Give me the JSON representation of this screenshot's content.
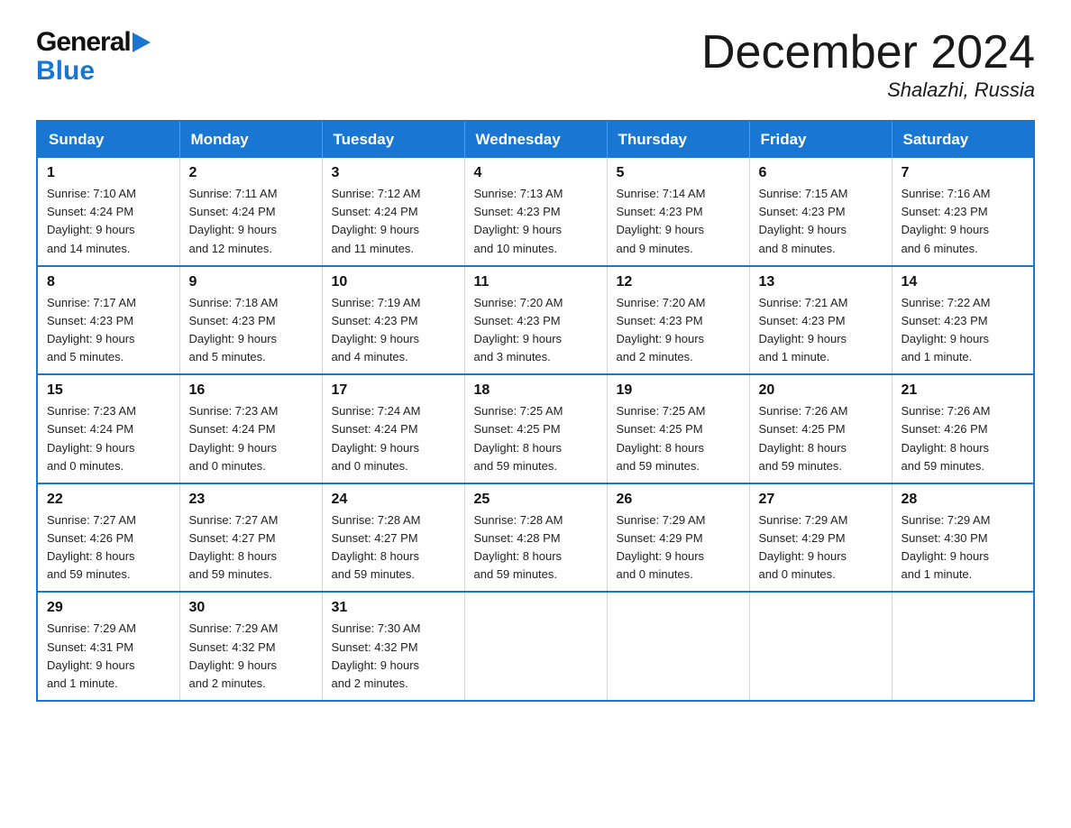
{
  "header": {
    "logo_general": "General",
    "logo_blue": "Blue",
    "month_title": "December 2024",
    "location": "Shalazhi, Russia"
  },
  "days_of_week": [
    "Sunday",
    "Monday",
    "Tuesday",
    "Wednesday",
    "Thursday",
    "Friday",
    "Saturday"
  ],
  "weeks": [
    [
      {
        "day": "1",
        "sunrise": "7:10 AM",
        "sunset": "4:24 PM",
        "daylight": "9 hours and 14 minutes."
      },
      {
        "day": "2",
        "sunrise": "7:11 AM",
        "sunset": "4:24 PM",
        "daylight": "9 hours and 12 minutes."
      },
      {
        "day": "3",
        "sunrise": "7:12 AM",
        "sunset": "4:24 PM",
        "daylight": "9 hours and 11 minutes."
      },
      {
        "day": "4",
        "sunrise": "7:13 AM",
        "sunset": "4:23 PM",
        "daylight": "9 hours and 10 minutes."
      },
      {
        "day": "5",
        "sunrise": "7:14 AM",
        "sunset": "4:23 PM",
        "daylight": "9 hours and 9 minutes."
      },
      {
        "day": "6",
        "sunrise": "7:15 AM",
        "sunset": "4:23 PM",
        "daylight": "9 hours and 8 minutes."
      },
      {
        "day": "7",
        "sunrise": "7:16 AM",
        "sunset": "4:23 PM",
        "daylight": "9 hours and 6 minutes."
      }
    ],
    [
      {
        "day": "8",
        "sunrise": "7:17 AM",
        "sunset": "4:23 PM",
        "daylight": "9 hours and 5 minutes."
      },
      {
        "day": "9",
        "sunrise": "7:18 AM",
        "sunset": "4:23 PM",
        "daylight": "9 hours and 5 minutes."
      },
      {
        "day": "10",
        "sunrise": "7:19 AM",
        "sunset": "4:23 PM",
        "daylight": "9 hours and 4 minutes."
      },
      {
        "day": "11",
        "sunrise": "7:20 AM",
        "sunset": "4:23 PM",
        "daylight": "9 hours and 3 minutes."
      },
      {
        "day": "12",
        "sunrise": "7:20 AM",
        "sunset": "4:23 PM",
        "daylight": "9 hours and 2 minutes."
      },
      {
        "day": "13",
        "sunrise": "7:21 AM",
        "sunset": "4:23 PM",
        "daylight": "9 hours and 1 minute."
      },
      {
        "day": "14",
        "sunrise": "7:22 AM",
        "sunset": "4:23 PM",
        "daylight": "9 hours and 1 minute."
      }
    ],
    [
      {
        "day": "15",
        "sunrise": "7:23 AM",
        "sunset": "4:24 PM",
        "daylight": "9 hours and 0 minutes."
      },
      {
        "day": "16",
        "sunrise": "7:23 AM",
        "sunset": "4:24 PM",
        "daylight": "9 hours and 0 minutes."
      },
      {
        "day": "17",
        "sunrise": "7:24 AM",
        "sunset": "4:24 PM",
        "daylight": "9 hours and 0 minutes."
      },
      {
        "day": "18",
        "sunrise": "7:25 AM",
        "sunset": "4:25 PM",
        "daylight": "8 hours and 59 minutes."
      },
      {
        "day": "19",
        "sunrise": "7:25 AM",
        "sunset": "4:25 PM",
        "daylight": "8 hours and 59 minutes."
      },
      {
        "day": "20",
        "sunrise": "7:26 AM",
        "sunset": "4:25 PM",
        "daylight": "8 hours and 59 minutes."
      },
      {
        "day": "21",
        "sunrise": "7:26 AM",
        "sunset": "4:26 PM",
        "daylight": "8 hours and 59 minutes."
      }
    ],
    [
      {
        "day": "22",
        "sunrise": "7:27 AM",
        "sunset": "4:26 PM",
        "daylight": "8 hours and 59 minutes."
      },
      {
        "day": "23",
        "sunrise": "7:27 AM",
        "sunset": "4:27 PM",
        "daylight": "8 hours and 59 minutes."
      },
      {
        "day": "24",
        "sunrise": "7:28 AM",
        "sunset": "4:27 PM",
        "daylight": "8 hours and 59 minutes."
      },
      {
        "day": "25",
        "sunrise": "7:28 AM",
        "sunset": "4:28 PM",
        "daylight": "8 hours and 59 minutes."
      },
      {
        "day": "26",
        "sunrise": "7:29 AM",
        "sunset": "4:29 PM",
        "daylight": "9 hours and 0 minutes."
      },
      {
        "day": "27",
        "sunrise": "7:29 AM",
        "sunset": "4:29 PM",
        "daylight": "9 hours and 0 minutes."
      },
      {
        "day": "28",
        "sunrise": "7:29 AM",
        "sunset": "4:30 PM",
        "daylight": "9 hours and 1 minute."
      }
    ],
    [
      {
        "day": "29",
        "sunrise": "7:29 AM",
        "sunset": "4:31 PM",
        "daylight": "9 hours and 1 minute."
      },
      {
        "day": "30",
        "sunrise": "7:29 AM",
        "sunset": "4:32 PM",
        "daylight": "9 hours and 2 minutes."
      },
      {
        "day": "31",
        "sunrise": "7:30 AM",
        "sunset": "4:32 PM",
        "daylight": "9 hours and 2 minutes."
      },
      null,
      null,
      null,
      null
    ]
  ],
  "labels": {
    "sunrise": "Sunrise:",
    "sunset": "Sunset:",
    "daylight": "Daylight:"
  }
}
